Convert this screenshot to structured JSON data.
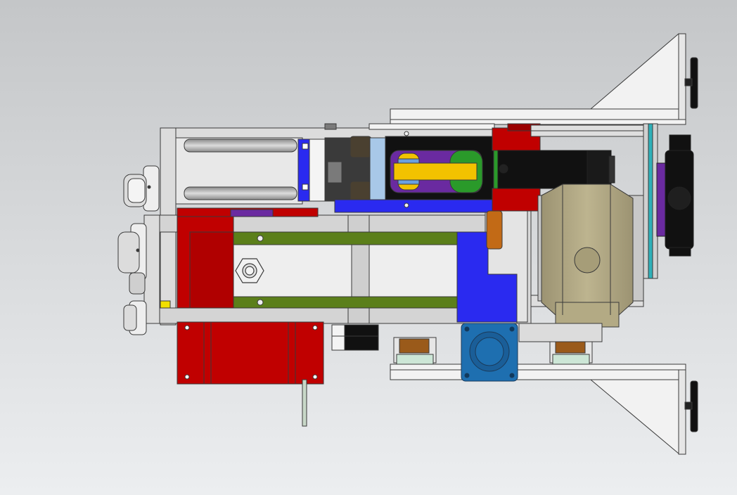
{
  "view": {
    "background_top": "#c4c6c8",
    "background_bottom": "#eceef0"
  },
  "colors": {
    "frame": "#dcdcdc",
    "frame_dark": "#b8b8b8",
    "outline": "#3a3a3a",
    "red": "#c00000",
    "dark_red": "#9a0000",
    "blue": "#2a2af0",
    "steel_blue": "#1e6fb0",
    "green": "#5b7f1a",
    "bright_green": "#2a9a2a",
    "purple": "#6a2aa0",
    "yellow": "#f2c200",
    "khaki": "#b3aa84",
    "black": "#111111",
    "brown": "#9a5a1a",
    "orange_brown": "#c26a16",
    "light_blue": "#a8c8e8",
    "teal": "#2fb0b8",
    "white_plate": "#f2f2f2"
  },
  "components": [
    {
      "id": "triangular-bracket-top",
      "color": "white_plate"
    },
    {
      "id": "triangular-bracket-bottom",
      "color": "white_plate"
    },
    {
      "id": "main-frame",
      "color": "frame"
    },
    {
      "id": "pneumatic-cylinder",
      "color": "frame"
    },
    {
      "id": "gripper-jaw",
      "color": "black"
    },
    {
      "id": "red-mounting-plate",
      "color": "red"
    },
    {
      "id": "gear-motor",
      "color": "khaki"
    },
    {
      "id": "servo-flange",
      "color": "steel_blue"
    },
    {
      "id": "linear-guide-blocks",
      "color": "brown"
    },
    {
      "id": "idler-rollers",
      "color": "frame"
    },
    {
      "id": "timing-pulley",
      "color": "black"
    },
    {
      "id": "hex-nut",
      "color": "frame"
    }
  ]
}
